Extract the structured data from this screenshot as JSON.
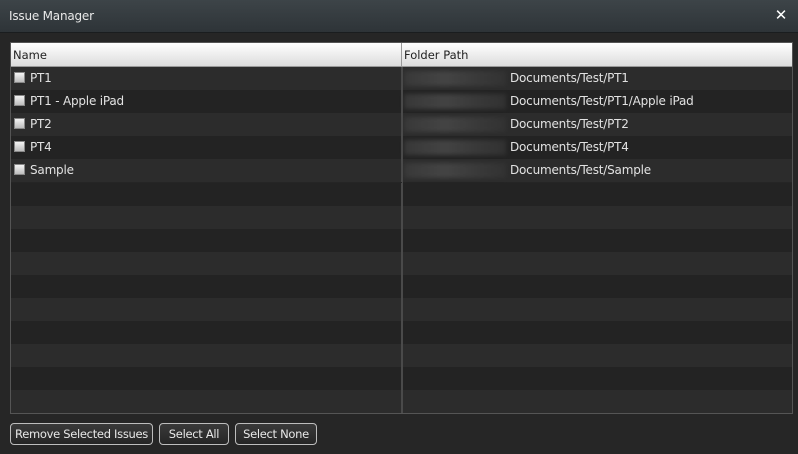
{
  "window": {
    "title": "Issue Manager",
    "close_glyph": "✕"
  },
  "table": {
    "columns": {
      "name": "Name",
      "path": "Folder Path"
    },
    "rows": [
      {
        "name": "PT1",
        "path": "Documents/Test/PT1"
      },
      {
        "name": "PT1 - Apple iPad",
        "path": "Documents/Test/PT1/Apple iPad"
      },
      {
        "name": "PT2",
        "path": "Documents/Test/PT2"
      },
      {
        "name": "PT4",
        "path": "Documents/Test/PT4"
      },
      {
        "name": "Sample",
        "path": "Documents/Test/Sample"
      }
    ]
  },
  "buttons": {
    "remove": "Remove Selected Issues",
    "select_all": "Select All",
    "select_none": "Select None"
  }
}
